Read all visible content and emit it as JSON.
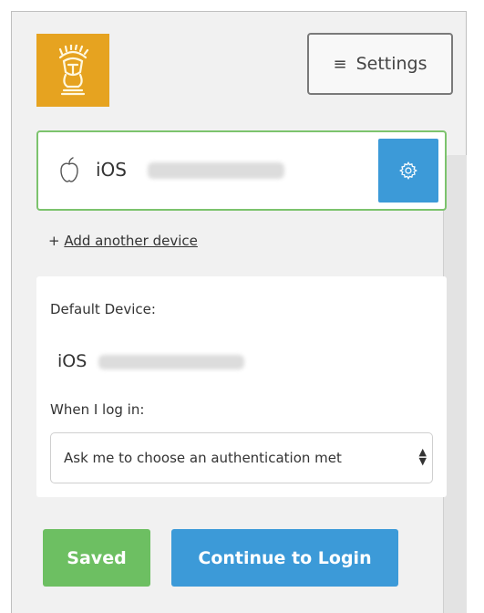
{
  "header": {
    "settings_label": "Settings",
    "logo_icon": "trojan-helmet-logo",
    "brand_color": "#e6a320"
  },
  "device": {
    "name": "iOS",
    "icon": "apple-icon",
    "settings_icon": "gear-icon",
    "accent": "#7cc36d"
  },
  "add_device": {
    "prefix": "+",
    "label": "Add another device"
  },
  "defaults": {
    "default_device_label": "Default Device:",
    "default_device_value": "iOS",
    "when_login_label": "When I log in:",
    "login_option": "Ask me to choose an authentication met"
  },
  "actions": {
    "saved_label": "Saved",
    "continue_label": "Continue to Login",
    "saved_color": "#6dbf62",
    "continue_color": "#3c9ad8"
  }
}
